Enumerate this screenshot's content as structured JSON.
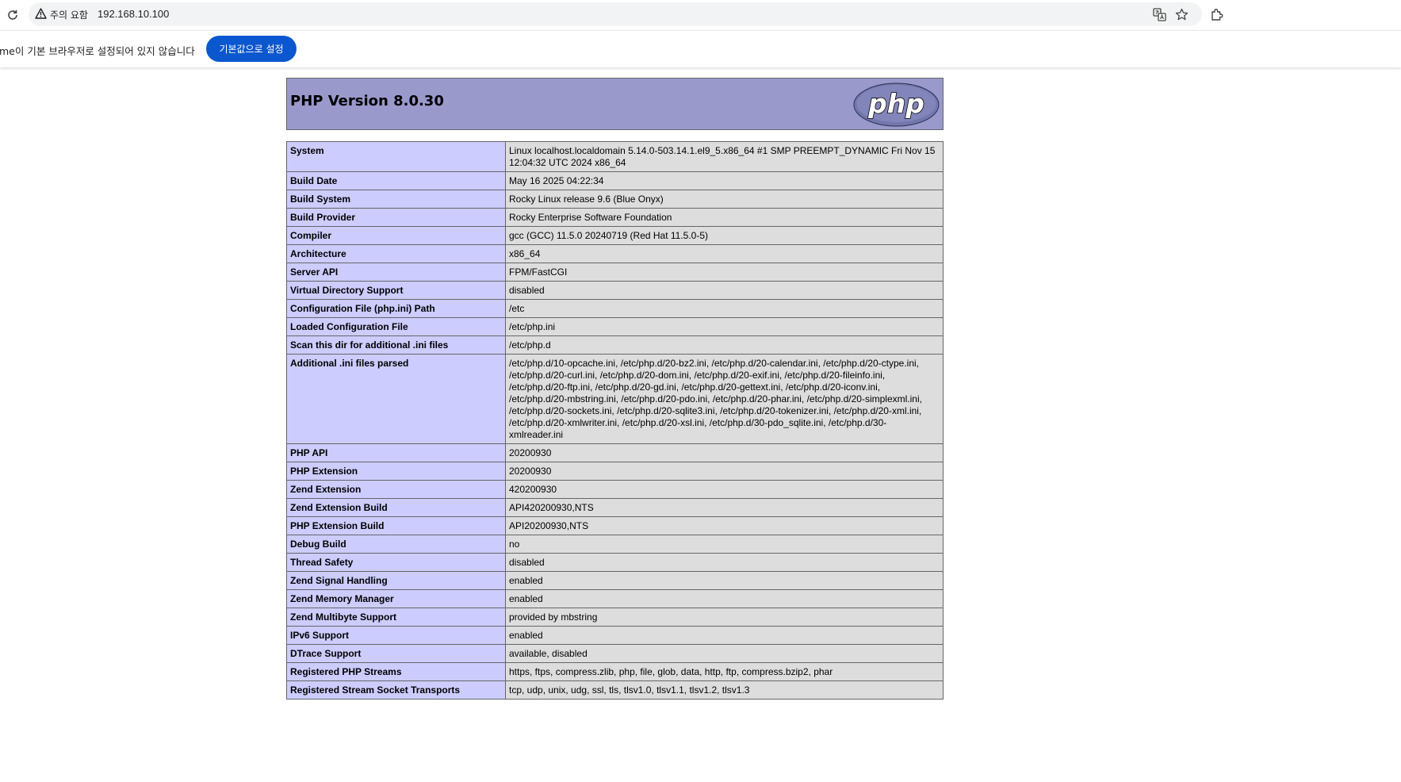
{
  "browser": {
    "security_label": "주의 요함",
    "url": "192.168.10.100",
    "icons": [
      "reload-icon",
      "warning-icon",
      "translate-icon",
      "star-icon",
      "extensions-icon"
    ]
  },
  "infobar": {
    "message": "me이 기본 브라우저로 설정되어 있지 않습니다",
    "button_label": "기본값으로 설정"
  },
  "phpinfo": {
    "title": "PHP Version 8.0.30",
    "logo_text": "php",
    "colors": {
      "header": "#9999cc",
      "key": "#ccccff",
      "value": "#dddddd",
      "button": "#0b57d0"
    },
    "rows": [
      {
        "key": "System",
        "value": "Linux localhost.localdomain 5.14.0-503.14.1.el9_5.x86_64 #1 SMP PREEMPT_DYNAMIC Fri Nov 15 12:04:32 UTC 2024 x86_64"
      },
      {
        "key": "Build Date",
        "value": "May 16 2025 04:22:34"
      },
      {
        "key": "Build System",
        "value": "Rocky Linux release 9.6 (Blue Onyx)"
      },
      {
        "key": "Build Provider",
        "value": "Rocky Enterprise Software Foundation"
      },
      {
        "key": "Compiler",
        "value": "gcc (GCC) 11.5.0 20240719 (Red Hat 11.5.0-5)"
      },
      {
        "key": "Architecture",
        "value": "x86_64"
      },
      {
        "key": "Server API",
        "value": "FPM/FastCGI"
      },
      {
        "key": "Virtual Directory Support",
        "value": "disabled"
      },
      {
        "key": "Configuration File (php.ini) Path",
        "value": "/etc"
      },
      {
        "key": "Loaded Configuration File",
        "value": "/etc/php.ini"
      },
      {
        "key": "Scan this dir for additional .ini files",
        "value": "/etc/php.d"
      },
      {
        "key": "Additional .ini files parsed",
        "value": "/etc/php.d/10-opcache.ini, /etc/php.d/20-bz2.ini, /etc/php.d/20-calendar.ini, /etc/php.d/20-ctype.ini, /etc/php.d/20-curl.ini, /etc/php.d/20-dom.ini, /etc/php.d/20-exif.ini, /etc/php.d/20-fileinfo.ini, /etc/php.d/20-ftp.ini, /etc/php.d/20-gd.ini, /etc/php.d/20-gettext.ini, /etc/php.d/20-iconv.ini, /etc/php.d/20-mbstring.ini, /etc/php.d/20-pdo.ini, /etc/php.d/20-phar.ini, /etc/php.d/20-simplexml.ini, /etc/php.d/20-sockets.ini, /etc/php.d/20-sqlite3.ini, /etc/php.d/20-tokenizer.ini, /etc/php.d/20-xml.ini, /etc/php.d/20-xmlwriter.ini, /etc/php.d/20-xsl.ini, /etc/php.d/30-pdo_sqlite.ini, /etc/php.d/30-xmlreader.ini"
      },
      {
        "key": "PHP API",
        "value": "20200930"
      },
      {
        "key": "PHP Extension",
        "value": "20200930"
      },
      {
        "key": "Zend Extension",
        "value": "420200930"
      },
      {
        "key": "Zend Extension Build",
        "value": "API420200930,NTS"
      },
      {
        "key": "PHP Extension Build",
        "value": "API20200930,NTS"
      },
      {
        "key": "Debug Build",
        "value": "no"
      },
      {
        "key": "Thread Safety",
        "value": "disabled"
      },
      {
        "key": "Zend Signal Handling",
        "value": "enabled"
      },
      {
        "key": "Zend Memory Manager",
        "value": "enabled"
      },
      {
        "key": "Zend Multibyte Support",
        "value": "provided by mbstring"
      },
      {
        "key": "IPv6 Support",
        "value": "enabled"
      },
      {
        "key": "DTrace Support",
        "value": "available, disabled"
      },
      {
        "key": "Registered PHP Streams",
        "value": "https, ftps, compress.zlib, php, file, glob, data, http, ftp, compress.bzip2, phar"
      },
      {
        "key": "Registered Stream Socket Transports",
        "value": "tcp, udp, unix, udg, ssl, tls, tlsv1.0, tlsv1.1, tlsv1.2, tlsv1.3"
      }
    ]
  }
}
